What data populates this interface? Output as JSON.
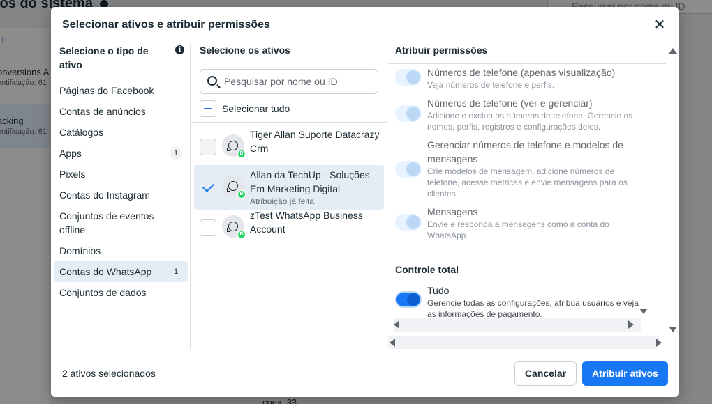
{
  "background": {
    "title": "ios do sistema",
    "search_placeholder": "Pesquisar por nome ou ID",
    "items": [
      {
        "label": "onversions A",
        "sub": "entificação: 61"
      },
      {
        "label": "acking",
        "sub": "entificação: 61"
      }
    ],
    "bottom_text": "coex_33"
  },
  "dialog": {
    "title": "Selecionar ativos e atribuir permissões",
    "type_column": {
      "title": "Selecione o tipo de ativo",
      "items": [
        {
          "label": "Páginas do Facebook",
          "count": ""
        },
        {
          "label": "Contas de anúncios",
          "count": ""
        },
        {
          "label": "Catálogos",
          "count": ""
        },
        {
          "label": "Apps",
          "count": "1"
        },
        {
          "label": "Pixels",
          "count": ""
        },
        {
          "label": "Contas do Instagram",
          "count": ""
        },
        {
          "label": "Conjuntos de eventos offline",
          "count": ""
        },
        {
          "label": "Domínios",
          "count": ""
        },
        {
          "label": "Contas do WhatsApp",
          "count": "1"
        },
        {
          "label": "Conjuntos de dados",
          "count": ""
        }
      ]
    },
    "assets_column": {
      "title": "Selecione os ativos",
      "search_placeholder": "Pesquisar por nome ou ID",
      "select_all_label": "Selecionar tudo",
      "assets": [
        {
          "name": "Tiger Allan Suporte Datacrazy Crm",
          "sub": "",
          "checked": false
        },
        {
          "name": "Allan da TechUp - Soluções Em Marketing Digital",
          "sub": "Atribuição já feita",
          "checked": true
        },
        {
          "name": "zTest WhatsApp Business Account",
          "sub": "",
          "checked": false
        }
      ]
    },
    "permissions_column": {
      "title": "Atribuir permissões",
      "permissions": [
        {
          "title": "Números de telefone (apenas visualização)",
          "desc": "Veja números de telefone e perfis.",
          "on": false
        },
        {
          "title": "Números de telefone (ver e gerenciar)",
          "desc": "Adicione e exclua os números de telefone. Gerencie os nomes, perfis, registros e configurações deles.",
          "on": false
        },
        {
          "title": "Gerenciar números de telefone e modelos de mensagens",
          "desc": "Crie modelos de mensagem, adicione números de telefone, acesse métricas e envie mensagens para os clientes.",
          "on": false
        },
        {
          "title": "Mensagens",
          "desc": "Envie e responda a mensagens como a conta do WhatsApp.",
          "on": false
        }
      ],
      "full_control_title": "Controle total",
      "full_control": {
        "title": "Tudo",
        "desc": "Gerencie todas as configurações, atribua usuários e veja as informações de pagamento.",
        "on": true
      }
    },
    "footer": {
      "selected_text": "2 ativos selecionados",
      "cancel_label": "Cancelar",
      "submit_label": "Atribuir ativos"
    }
  },
  "colors": {
    "primary": "#1877f2",
    "selected_bg": "#e4edf6",
    "text": "#1c2b33"
  },
  "icons": [
    "search-icon",
    "info-icon",
    "close-icon",
    "whatsapp-icon",
    "check-icon",
    "minus-icon"
  ]
}
